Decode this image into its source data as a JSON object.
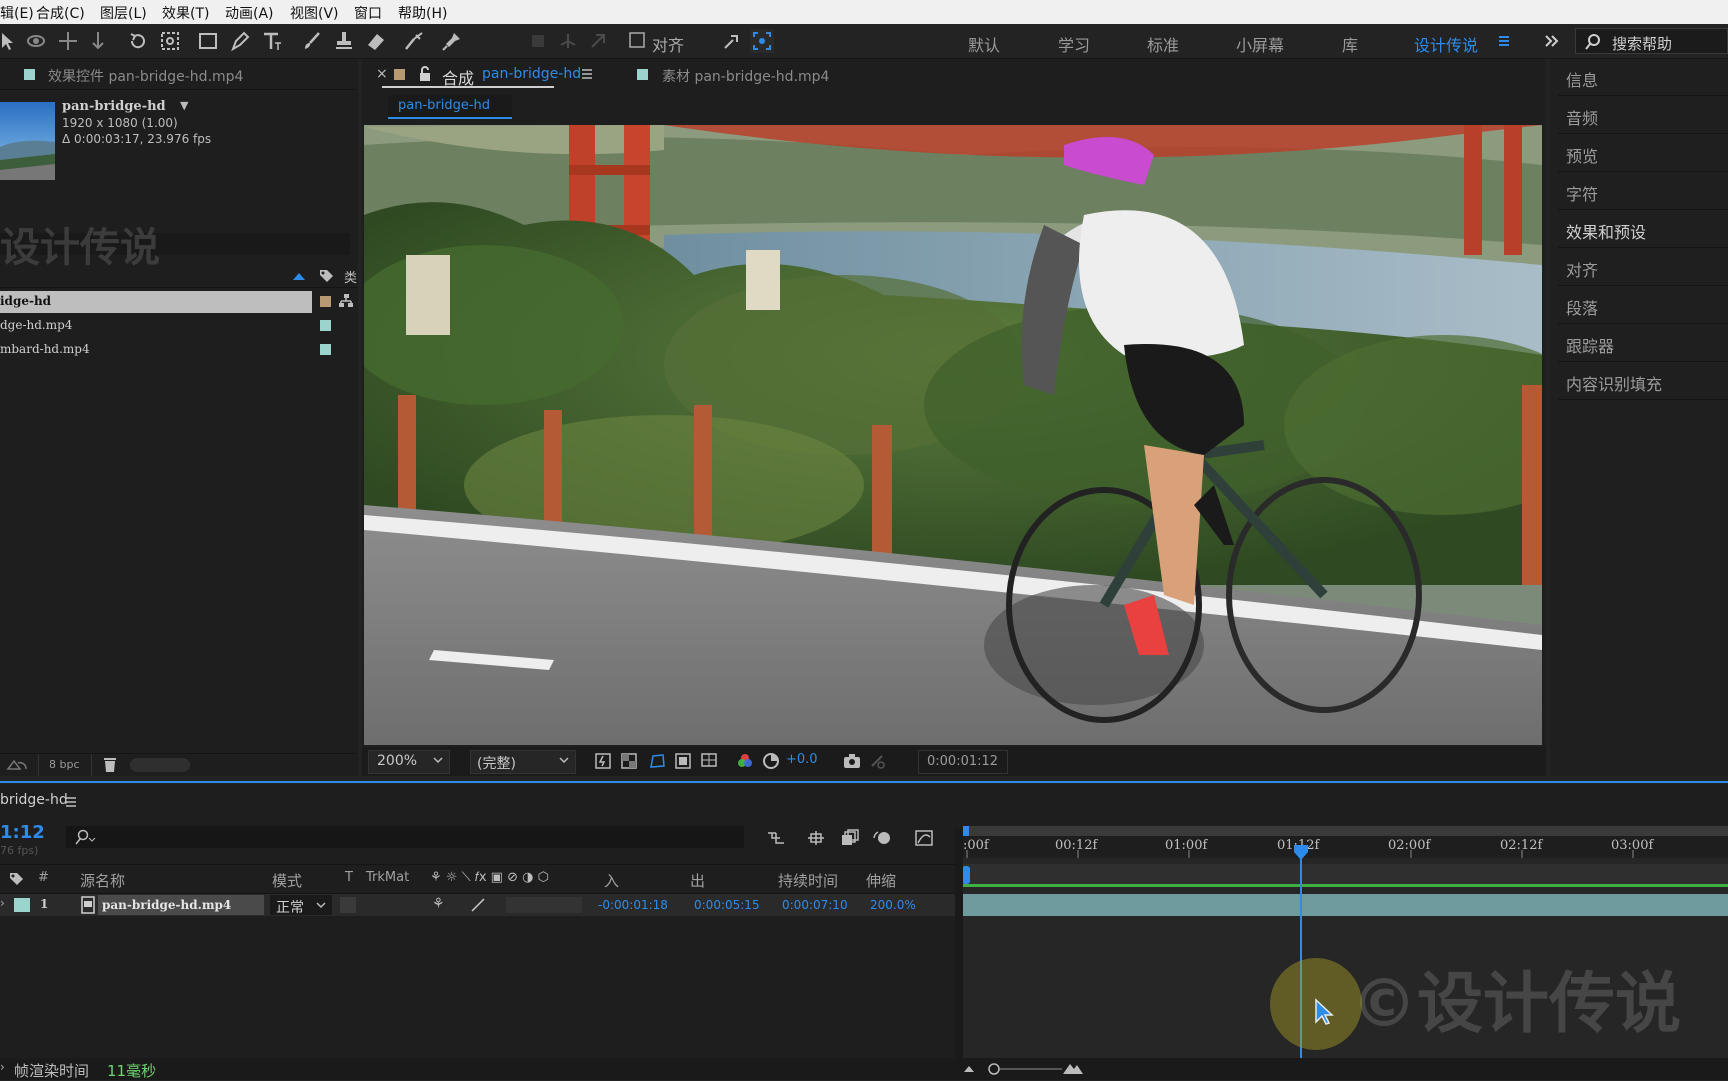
{
  "menu": [
    "辑(E)",
    "合成(C)",
    "图层(L)",
    "效果(T)",
    "动画(A)",
    "视图(V)",
    "窗口",
    "帮助(H)"
  ],
  "toolbar": {
    "snap_label": "对齐",
    "workspaces": [
      "默认",
      "学习",
      "标准",
      "小屏幕",
      "库",
      "设计传说"
    ],
    "help_search": "搜索帮助"
  },
  "effects_tab": "效果控件 pan-bridge-hd.mp4",
  "project": {
    "comp_name": "pan-bridge-hd",
    "resolution": "1920 x 1080 (1.00)",
    "duration": "Δ 0:00:03:17, 23.976 fps",
    "watermark": "设计传说",
    "items": [
      "idge-hd",
      "dge-hd.mp4",
      "mbard-hd.mp4"
    ],
    "bpc": "8 bpc"
  },
  "viewer": {
    "close": "×",
    "comp_tab_prefix": "合成",
    "comp_tab_name": "pan-bridge-hd",
    "footage_tab": "素材 pan-bridge-hd.mp4",
    "sub_tab": "pan-bridge-hd",
    "zoom": "200%",
    "quality": "(完整)",
    "exposure": "+0.0",
    "timecode": "0:00:01:12"
  },
  "right_panels": [
    "信息",
    "音频",
    "预览",
    "字符",
    "效果和预设",
    "对齐",
    "段落",
    "跟踪器",
    "内容识别填充"
  ],
  "timeline": {
    "comp_tab": "bridge-hd",
    "timecode": "1:12",
    "fps": "76 fps)",
    "columns": {
      "num": "#",
      "source": "源名称",
      "mode": "模式",
      "t": "T",
      "trkmat": "TrkMat",
      "in": "入",
      "out": "出",
      "duration": "持续时间",
      "stretch": "伸缩"
    },
    "layer": {
      "num": "1",
      "name": "pan-bridge-hd.mp4",
      "mode": "正常",
      "in": "-0:00:01:18",
      "out": "0:00:05:15",
      "duration": "0:00:07:10",
      "stretch": "200.0%"
    },
    "ruler": [
      ":00f",
      "00:12f",
      "01:00f",
      "01:12f",
      "02:00f",
      "02:12f",
      "03:00f"
    ],
    "watermark": "©设计传说"
  },
  "status": {
    "label": "帧渲染时间",
    "value": "11毫秒"
  },
  "colors": {
    "accent": "#2d8ceb",
    "layer_bar": "#6f9a9e",
    "label_teal": "#9bd4cc",
    "label_tan": "#b89a72"
  }
}
